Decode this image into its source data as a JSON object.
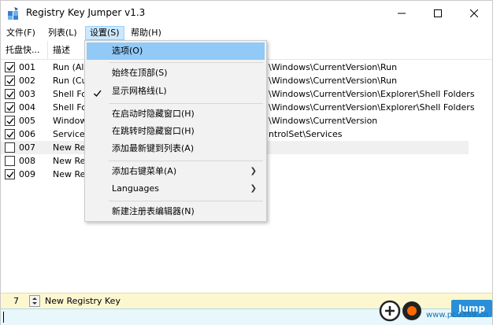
{
  "window": {
    "title": "Registry Key Jumper v1.3",
    "controls": {
      "minimize": "—",
      "maximize": "☐",
      "close": "✕"
    }
  },
  "menubar": {
    "items": [
      {
        "label": "文件(F)"
      },
      {
        "label": "列表(L)"
      },
      {
        "label": "设置(S)",
        "active": true
      },
      {
        "label": "帮助(H)"
      }
    ]
  },
  "list": {
    "columns": [
      "托盘快...",
      "描述"
    ],
    "rows": [
      {
        "checked": true,
        "id": "001",
        "desc": "Run (All",
        "path": "\\Windows\\CurrentVersion\\Run"
      },
      {
        "checked": true,
        "id": "002",
        "desc": "Run (Cu",
        "path": "\\Windows\\CurrentVersion\\Run"
      },
      {
        "checked": true,
        "id": "003",
        "desc": "Shell Fol",
        "path": "\\Windows\\CurrentVersion\\Explorer\\Shell Folders"
      },
      {
        "checked": true,
        "id": "004",
        "desc": "Shell Fol",
        "path": "\\Windows\\CurrentVersion\\Explorer\\Shell Folders"
      },
      {
        "checked": true,
        "id": "005",
        "desc": "Window",
        "path": "\\Windows\\CurrentVersion"
      },
      {
        "checked": true,
        "id": "006",
        "desc": "Services",
        "path": "ntrolSet\\Services"
      },
      {
        "checked": false,
        "id": "007",
        "desc": "New Reg",
        "path": ""
      },
      {
        "checked": false,
        "id": "008",
        "desc": "New Reg",
        "path": ""
      },
      {
        "checked": true,
        "id": "009",
        "desc": "New Reg",
        "path": ""
      }
    ]
  },
  "dropdown": {
    "items": [
      {
        "label": "选项(O)",
        "hover": true
      },
      {
        "label": "始终在顶部(S)"
      },
      {
        "label": "显示网格线(L)",
        "checked": true
      },
      {
        "label": "在启动时隐藏窗口(H)"
      },
      {
        "label": "在跳转时隐藏窗口(H)"
      },
      {
        "label": "添加最新键到列表(A)"
      },
      {
        "label": "添加右键菜单(A)",
        "submenu": true
      },
      {
        "label": "Languages",
        "submenu": true
      },
      {
        "label": "新建注册表编辑器(N)"
      }
    ]
  },
  "status": {
    "count": "7",
    "name": "New Registry Key"
  },
  "jump": {
    "label": "Jump",
    "watermark": "www.pc0359.cn"
  },
  "colors": {
    "menu_hover": "#91c9f7",
    "status_bg": "#fdf7d0",
    "input_bg": "#e8f7fb",
    "jump_blue": "#2a8fd8"
  }
}
